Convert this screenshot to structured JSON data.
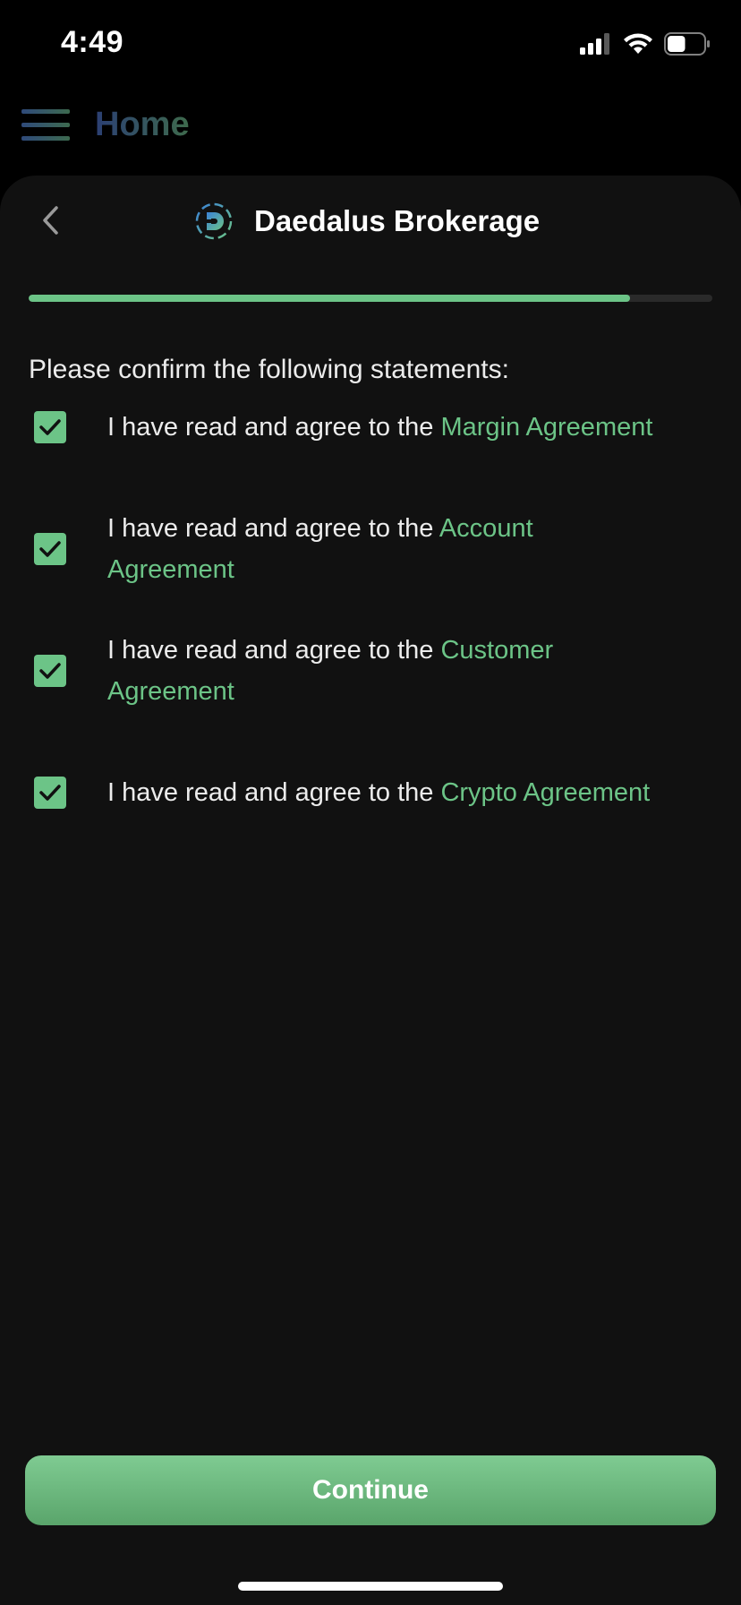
{
  "status_bar": {
    "time": "4:49",
    "battery_level": 0.5,
    "icons": [
      "cellular-signal-icon",
      "wifi-icon",
      "battery-icon"
    ]
  },
  "app_header": {
    "title": "Home",
    "menu_icon": "hamburger-menu-icon"
  },
  "sheet": {
    "back_icon": "chevron-left-icon",
    "brand_logo_icon": "daedalus-logo-icon",
    "title": "Daedalus Brokerage",
    "progress": 0.88,
    "instructions": "Please confirm the following statements:",
    "statements": [
      {
        "prefix": "I have read and agree to the ",
        "link": "Margin Agreement",
        "checked": true
      },
      {
        "prefix": "I have read and agree to the ",
        "link": "Account Agreement",
        "checked": true
      },
      {
        "prefix": "I have read and agree to the ",
        "link": "Customer Agreement",
        "checked": true
      },
      {
        "prefix": "I have read and agree to the ",
        "link": "Crypto Agreement",
        "checked": true
      }
    ],
    "continue_label": "Continue"
  },
  "colors": {
    "accent": "#6cc487",
    "background": "#111111",
    "track": "#2a2a2a"
  }
}
